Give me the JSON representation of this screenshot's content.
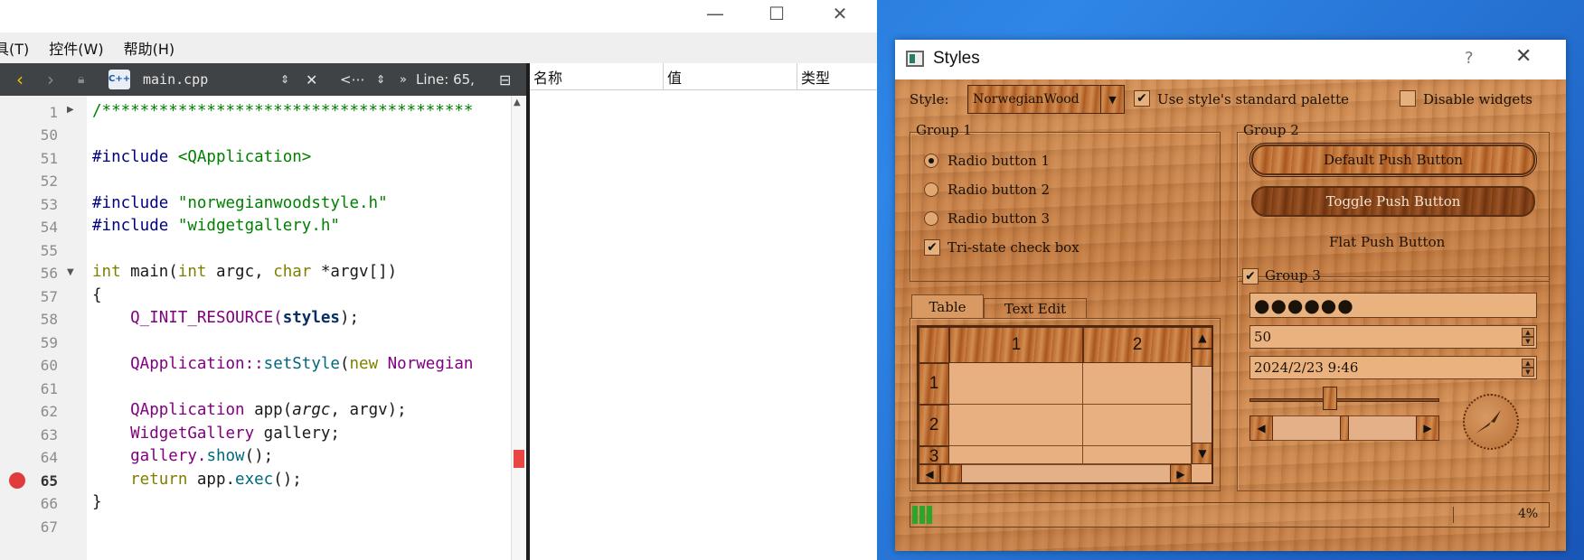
{
  "ide": {
    "menus": [
      "具(T)",
      "控件(W)",
      "帮助(H)"
    ],
    "toolbar": {
      "file_name": "main.cpp",
      "file_icon": "c++-file-icon",
      "symbol_combo": "<⋯",
      "line_info": "Line: 65,"
    },
    "locals_columns": [
      "名称",
      "值",
      "类型"
    ],
    "line_numbers": [
      "1",
      "50",
      "51",
      "52",
      "53",
      "54",
      "55",
      "56",
      "57",
      "58",
      "59",
      "60",
      "61",
      "62",
      "63",
      "64",
      "65",
      "66",
      "67"
    ],
    "current_line": "65",
    "code": {
      "l1": "/***************************************",
      "l51_a": "#include ",
      "l51_b": "<QApplication>",
      "l53_a": "#include ",
      "l53_b": "\"norwegianwoodstyle.h\"",
      "l54_a": "#include ",
      "l54_b": "\"widgetgallery.h\"",
      "l56_a": "int",
      "l56_b": " main(",
      "l56_c": "int",
      "l56_d": " argc, ",
      "l56_e": "char",
      "l56_f": " *argv[])",
      "l57": "{",
      "l58_a": "    Q_INIT_RESOURCE(",
      "l58_b": "styles",
      "l58_c": ");",
      "l60_a": "    QApplication::",
      "l60_b": "setStyle",
      "l60_c": "(",
      "l60_d": "new",
      "l60_e": " Norwegian",
      "l62_a": "    QApplication",
      "l62_b": " app(",
      "l62_c": "argc",
      "l62_d": ", argv);",
      "l63_a": "    WidgetGallery",
      "l63_b": " gallery;",
      "l64_a": "    gallery.",
      "l64_b": "show",
      "l64_c": "();",
      "l65_a": "    return",
      "l65_b": " app.",
      "l65_c": "exec",
      "l65_d": "();",
      "l66": "}"
    }
  },
  "dialog": {
    "title": "Styles",
    "help_glyph": "?",
    "style_label": "Style:",
    "style_value": "NorwegianWood",
    "use_palette_label": "Use style's standard palette",
    "use_palette_checked": true,
    "disable_widgets_label": "Disable widgets",
    "disable_widgets_checked": false,
    "group1": {
      "title": "Group 1",
      "radio1": "Radio button 1",
      "radio2": "Radio button 2",
      "radio3": "Radio button 3",
      "tristate": "Tri-state check box"
    },
    "group2": {
      "title": "Group 2",
      "default_button": "Default Push Button",
      "toggle_button": "Toggle Push Button",
      "flat_button": "Flat Push Button"
    },
    "tabs": [
      "Table",
      "Text Edit"
    ],
    "table": {
      "columns": [
        "1",
        "2"
      ],
      "rows": [
        "1",
        "2",
        "3"
      ]
    },
    "group3": {
      "title": "Group 3",
      "password": "●●●●●●",
      "spin_value": "50",
      "datetime": "2024/2/23 9:46",
      "slider_value": 0.42,
      "scrollbar_value": 0.5
    },
    "progress": {
      "value_text": "4%",
      "value": 0.04
    },
    "colors": {
      "wood": "#c9874e",
      "toolbar": "#3f4346",
      "breakpoint": "#e03c3c",
      "progress": "#2aa62a"
    }
  }
}
